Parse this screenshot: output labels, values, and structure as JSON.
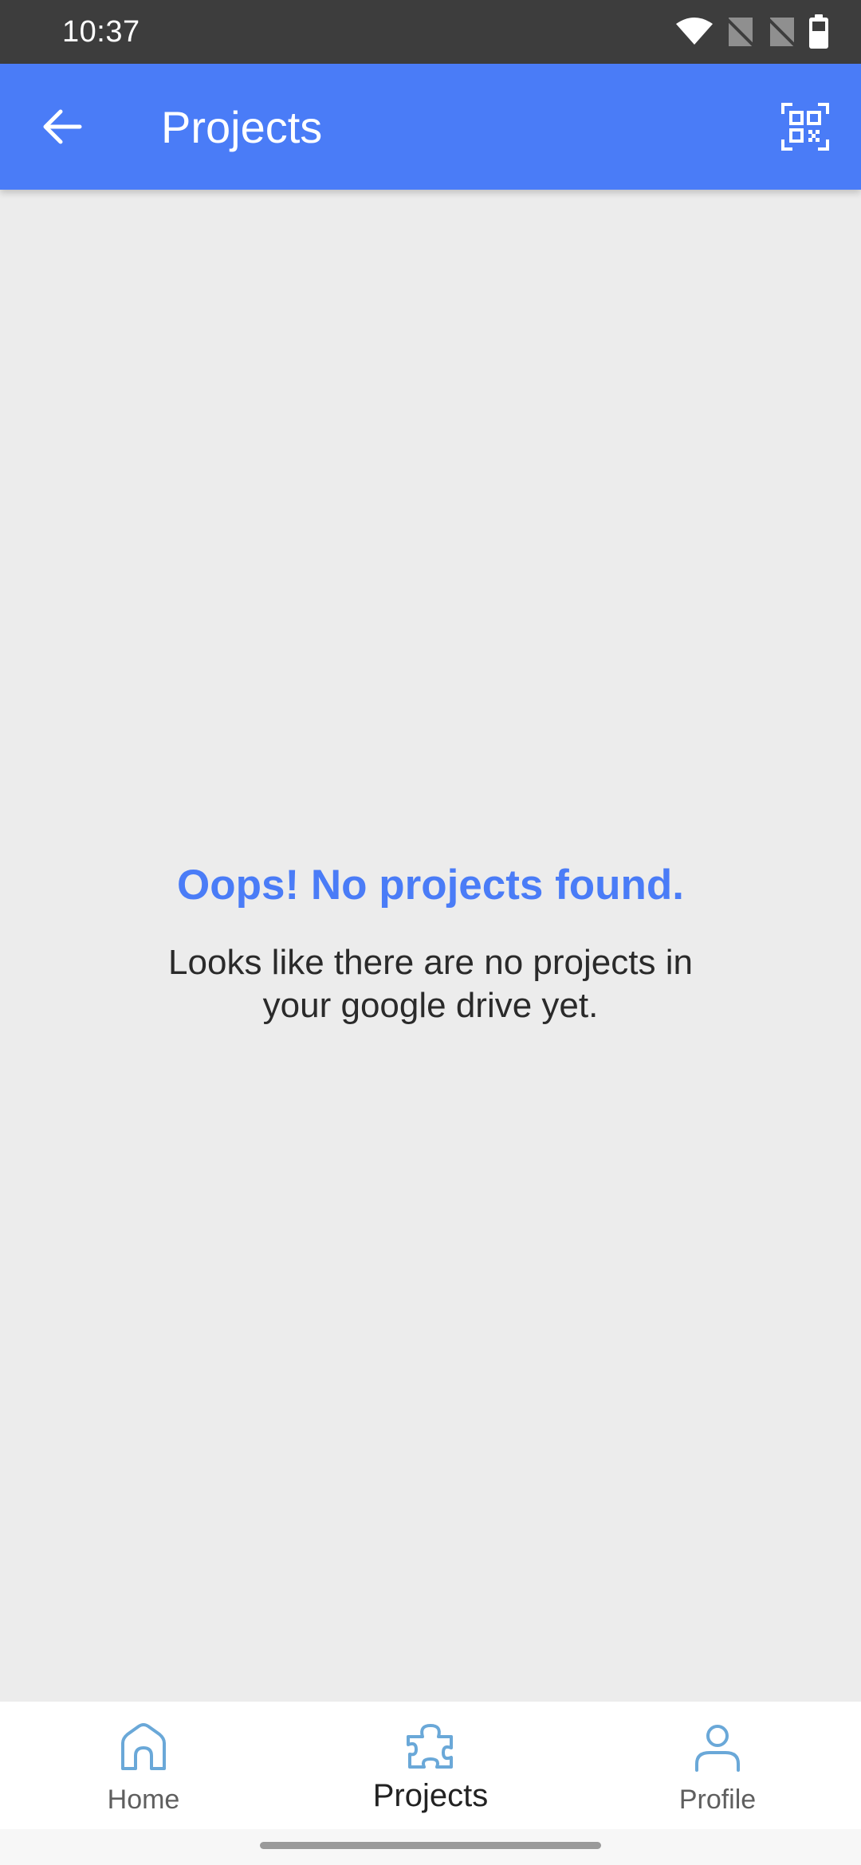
{
  "status_bar": {
    "time": "10:37",
    "icons": [
      "wifi-icon",
      "no-sim-icon",
      "no-sim-icon",
      "battery-icon"
    ]
  },
  "app_bar": {
    "title": "Projects",
    "back_icon": "arrow-left-icon",
    "action_icon": "qr-code-scan-icon",
    "background_color": "#4a7cf7"
  },
  "empty_state": {
    "title": "Oops! No projects found.",
    "message": "Looks like there are no projects in your google drive yet.",
    "title_color": "#4a7cf7"
  },
  "bottom_nav": {
    "items": [
      {
        "label": "Home",
        "icon": "home-icon",
        "active": false
      },
      {
        "label": "Projects",
        "icon": "puzzle-icon",
        "active": true
      },
      {
        "label": "Profile",
        "icon": "person-icon",
        "active": false
      }
    ],
    "icon_color": "#6aa8d8"
  }
}
